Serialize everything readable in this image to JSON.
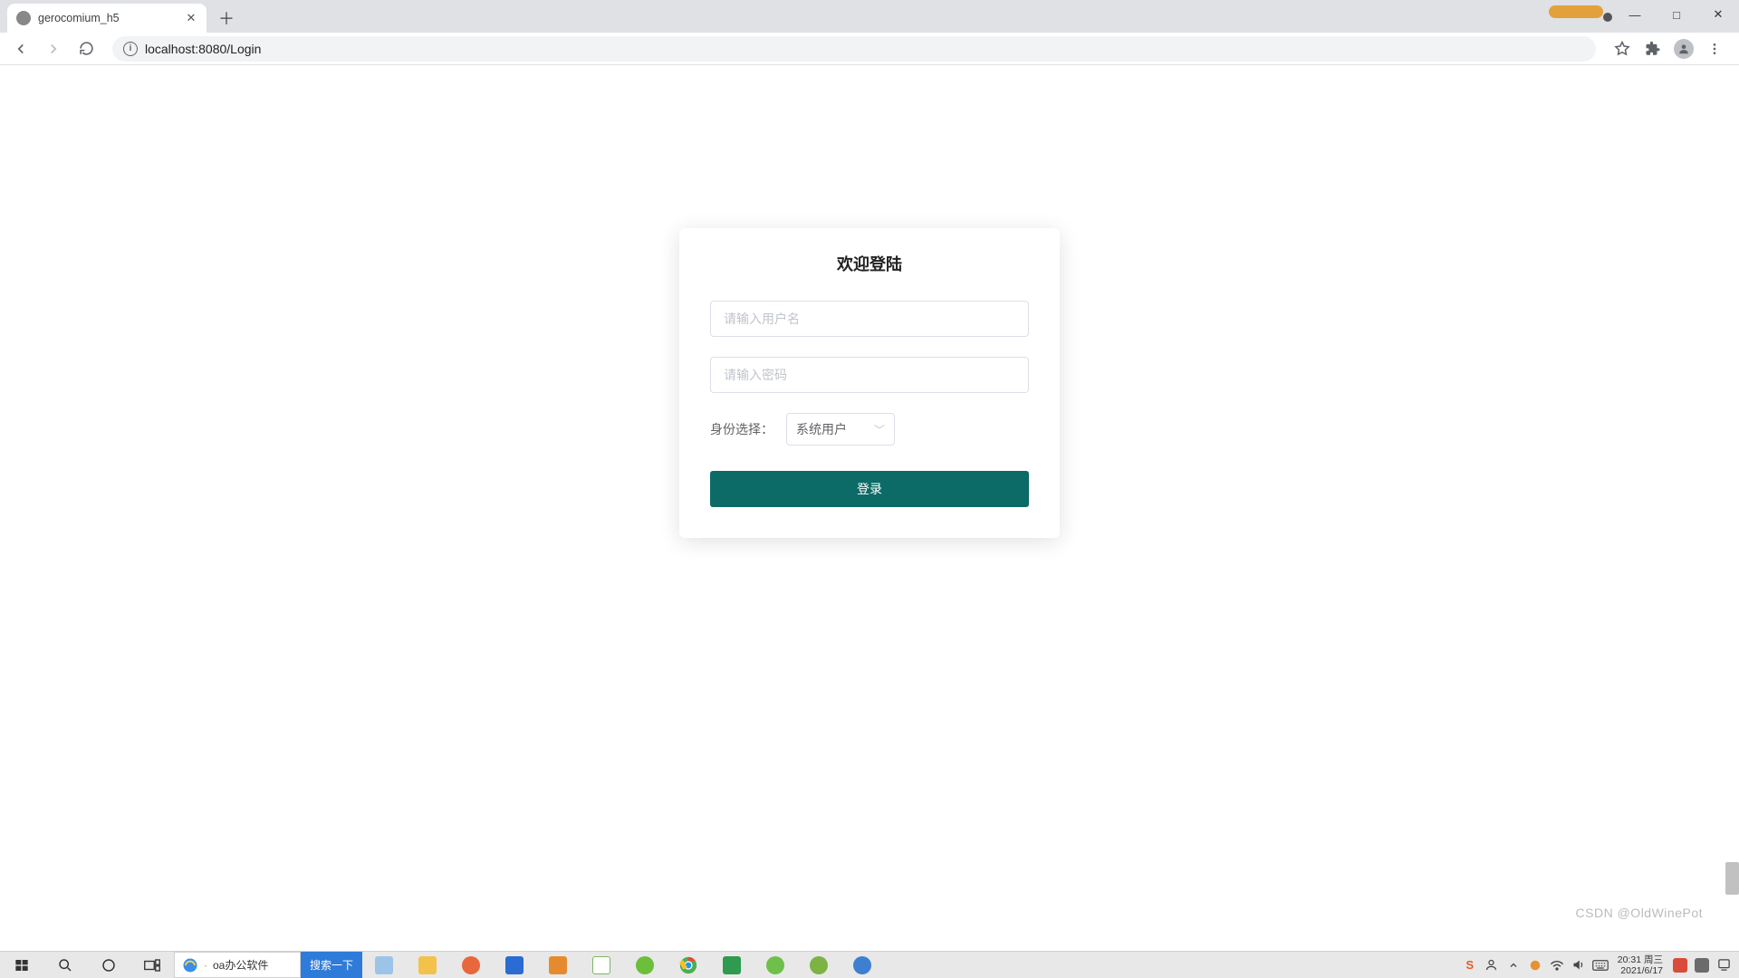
{
  "browser": {
    "tab_title": "gerocomium_h5",
    "url": "localhost:8080/Login"
  },
  "login": {
    "title": "欢迎登陆",
    "username_placeholder": "请输入用户名",
    "password_placeholder": "请输入密码",
    "role_label": "身份选择：",
    "role_value": "系统用户",
    "submit_label": "登录"
  },
  "taskbar": {
    "search_text": "oa办公软件",
    "search_button": "搜索一下",
    "clock_time": "20:31",
    "clock_day": "周三",
    "clock_date": "2021/6/17"
  },
  "watermark": "CSDN @OldWinePot"
}
